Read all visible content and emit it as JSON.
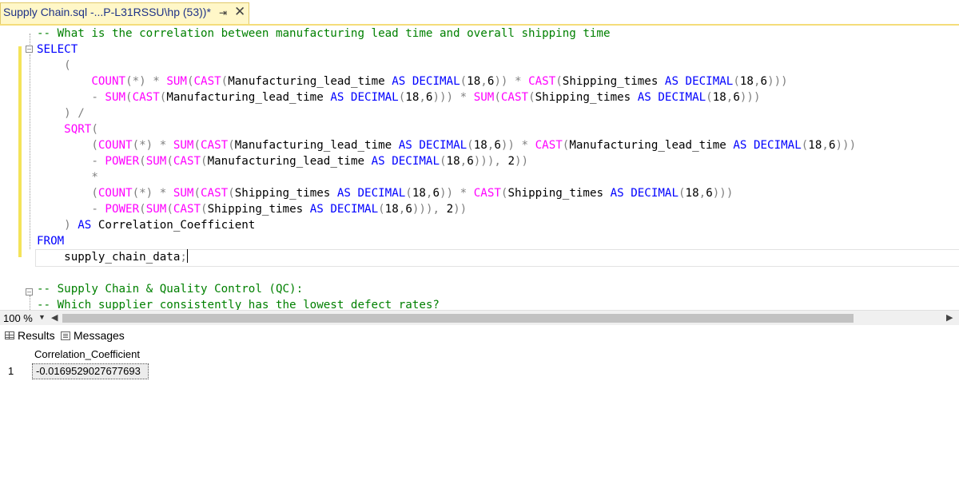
{
  "tab": {
    "title": "Supply Chain.sql -...P-L31RSSU\\hp (53))*",
    "pin_icon": "pin-icon",
    "close_icon": "close-icon"
  },
  "editor": {
    "lines": [
      [
        {
          "t": "-- What is the correlation between manufacturing lead time and overall shipping time",
          "c": "cm"
        }
      ],
      [
        {
          "t": "SELECT",
          "c": "kw"
        }
      ],
      [
        {
          "t": "    (",
          "c": "gr"
        }
      ],
      [
        {
          "t": "        ",
          "c": "tx"
        },
        {
          "t": "COUNT",
          "c": "fn"
        },
        {
          "t": "(*) * ",
          "c": "gr"
        },
        {
          "t": "SUM",
          "c": "fn"
        },
        {
          "t": "(",
          "c": "gr"
        },
        {
          "t": "CAST",
          "c": "fn"
        },
        {
          "t": "(",
          "c": "gr"
        },
        {
          "t": "Manufacturing_lead_time ",
          "c": "tx"
        },
        {
          "t": "AS DECIMAL",
          "c": "kw"
        },
        {
          "t": "(",
          "c": "gr"
        },
        {
          "t": "18",
          "c": "tx"
        },
        {
          "t": ",",
          "c": "gr"
        },
        {
          "t": "6",
          "c": "tx"
        },
        {
          "t": ")) * ",
          "c": "gr"
        },
        {
          "t": "CAST",
          "c": "fn"
        },
        {
          "t": "(",
          "c": "gr"
        },
        {
          "t": "Shipping_times ",
          "c": "tx"
        },
        {
          "t": "AS DECIMAL",
          "c": "kw"
        },
        {
          "t": "(",
          "c": "gr"
        },
        {
          "t": "18",
          "c": "tx"
        },
        {
          "t": ",",
          "c": "gr"
        },
        {
          "t": "6",
          "c": "tx"
        },
        {
          "t": ")))",
          "c": "gr"
        }
      ],
      [
        {
          "t": "        - ",
          "c": "gr"
        },
        {
          "t": "SUM",
          "c": "fn"
        },
        {
          "t": "(",
          "c": "gr"
        },
        {
          "t": "CAST",
          "c": "fn"
        },
        {
          "t": "(",
          "c": "gr"
        },
        {
          "t": "Manufacturing_lead_time ",
          "c": "tx"
        },
        {
          "t": "AS DECIMAL",
          "c": "kw"
        },
        {
          "t": "(",
          "c": "gr"
        },
        {
          "t": "18",
          "c": "tx"
        },
        {
          "t": ",",
          "c": "gr"
        },
        {
          "t": "6",
          "c": "tx"
        },
        {
          "t": "))) * ",
          "c": "gr"
        },
        {
          "t": "SUM",
          "c": "fn"
        },
        {
          "t": "(",
          "c": "gr"
        },
        {
          "t": "CAST",
          "c": "fn"
        },
        {
          "t": "(",
          "c": "gr"
        },
        {
          "t": "Shipping_times ",
          "c": "tx"
        },
        {
          "t": "AS DECIMAL",
          "c": "kw"
        },
        {
          "t": "(",
          "c": "gr"
        },
        {
          "t": "18",
          "c": "tx"
        },
        {
          "t": ",",
          "c": "gr"
        },
        {
          "t": "6",
          "c": "tx"
        },
        {
          "t": ")))",
          "c": "gr"
        }
      ],
      [
        {
          "t": "    ) /",
          "c": "gr"
        }
      ],
      [
        {
          "t": "    ",
          "c": "tx"
        },
        {
          "t": "SQRT",
          "c": "fn"
        },
        {
          "t": "(",
          "c": "gr"
        }
      ],
      [
        {
          "t": "        (",
          "c": "gr"
        },
        {
          "t": "COUNT",
          "c": "fn"
        },
        {
          "t": "(*) * ",
          "c": "gr"
        },
        {
          "t": "SUM",
          "c": "fn"
        },
        {
          "t": "(",
          "c": "gr"
        },
        {
          "t": "CAST",
          "c": "fn"
        },
        {
          "t": "(",
          "c": "gr"
        },
        {
          "t": "Manufacturing_lead_time ",
          "c": "tx"
        },
        {
          "t": "AS DECIMAL",
          "c": "kw"
        },
        {
          "t": "(",
          "c": "gr"
        },
        {
          "t": "18",
          "c": "tx"
        },
        {
          "t": ",",
          "c": "gr"
        },
        {
          "t": "6",
          "c": "tx"
        },
        {
          "t": ")) * ",
          "c": "gr"
        },
        {
          "t": "CAST",
          "c": "fn"
        },
        {
          "t": "(",
          "c": "gr"
        },
        {
          "t": "Manufacturing_lead_time ",
          "c": "tx"
        },
        {
          "t": "AS DECIMAL",
          "c": "kw"
        },
        {
          "t": "(",
          "c": "gr"
        },
        {
          "t": "18",
          "c": "tx"
        },
        {
          "t": ",",
          "c": "gr"
        },
        {
          "t": "6",
          "c": "tx"
        },
        {
          "t": ")))",
          "c": "gr"
        }
      ],
      [
        {
          "t": "        - ",
          "c": "gr"
        },
        {
          "t": "POWER",
          "c": "fn"
        },
        {
          "t": "(",
          "c": "gr"
        },
        {
          "t": "SUM",
          "c": "fn"
        },
        {
          "t": "(",
          "c": "gr"
        },
        {
          "t": "CAST",
          "c": "fn"
        },
        {
          "t": "(",
          "c": "gr"
        },
        {
          "t": "Manufacturing_lead_time ",
          "c": "tx"
        },
        {
          "t": "AS DECIMAL",
          "c": "kw"
        },
        {
          "t": "(",
          "c": "gr"
        },
        {
          "t": "18",
          "c": "tx"
        },
        {
          "t": ",",
          "c": "gr"
        },
        {
          "t": "6",
          "c": "tx"
        },
        {
          "t": "))), ",
          "c": "gr"
        },
        {
          "t": "2",
          "c": "tx"
        },
        {
          "t": "))",
          "c": "gr"
        }
      ],
      [
        {
          "t": "        *",
          "c": "gr"
        }
      ],
      [
        {
          "t": "        (",
          "c": "gr"
        },
        {
          "t": "COUNT",
          "c": "fn"
        },
        {
          "t": "(*) * ",
          "c": "gr"
        },
        {
          "t": "SUM",
          "c": "fn"
        },
        {
          "t": "(",
          "c": "gr"
        },
        {
          "t": "CAST",
          "c": "fn"
        },
        {
          "t": "(",
          "c": "gr"
        },
        {
          "t": "Shipping_times ",
          "c": "tx"
        },
        {
          "t": "AS DECIMAL",
          "c": "kw"
        },
        {
          "t": "(",
          "c": "gr"
        },
        {
          "t": "18",
          "c": "tx"
        },
        {
          "t": ",",
          "c": "gr"
        },
        {
          "t": "6",
          "c": "tx"
        },
        {
          "t": ")) * ",
          "c": "gr"
        },
        {
          "t": "CAST",
          "c": "fn"
        },
        {
          "t": "(",
          "c": "gr"
        },
        {
          "t": "Shipping_times ",
          "c": "tx"
        },
        {
          "t": "AS DECIMAL",
          "c": "kw"
        },
        {
          "t": "(",
          "c": "gr"
        },
        {
          "t": "18",
          "c": "tx"
        },
        {
          "t": ",",
          "c": "gr"
        },
        {
          "t": "6",
          "c": "tx"
        },
        {
          "t": ")))",
          "c": "gr"
        }
      ],
      [
        {
          "t": "        - ",
          "c": "gr"
        },
        {
          "t": "POWER",
          "c": "fn"
        },
        {
          "t": "(",
          "c": "gr"
        },
        {
          "t": "SUM",
          "c": "fn"
        },
        {
          "t": "(",
          "c": "gr"
        },
        {
          "t": "CAST",
          "c": "fn"
        },
        {
          "t": "(",
          "c": "gr"
        },
        {
          "t": "Shipping_times ",
          "c": "tx"
        },
        {
          "t": "AS DECIMAL",
          "c": "kw"
        },
        {
          "t": "(",
          "c": "gr"
        },
        {
          "t": "18",
          "c": "tx"
        },
        {
          "t": ",",
          "c": "gr"
        },
        {
          "t": "6",
          "c": "tx"
        },
        {
          "t": "))), ",
          "c": "gr"
        },
        {
          "t": "2",
          "c": "tx"
        },
        {
          "t": "))",
          "c": "gr"
        }
      ],
      [
        {
          "t": "    ) ",
          "c": "gr"
        },
        {
          "t": "AS ",
          "c": "kw"
        },
        {
          "t": "Correlation_Coefficient",
          "c": "tx"
        }
      ],
      [
        {
          "t": "FROM",
          "c": "kw"
        }
      ],
      [
        {
          "t": "    supply_chain_data",
          "c": "tx"
        },
        {
          "t": ";",
          "c": "gr"
        }
      ],
      [
        {
          "t": "",
          "c": "tx"
        }
      ],
      [
        {
          "t": "-- Supply Chain & Quality Control (QC):",
          "c": "cm"
        }
      ],
      [
        {
          "t": "-- Which supplier consistently has the lowest defect rates?",
          "c": "cm"
        }
      ]
    ]
  },
  "zoom": {
    "level": "100 %"
  },
  "results": {
    "tabs": [
      {
        "label": "Results",
        "icon": "grid-icon"
      },
      {
        "label": "Messages",
        "icon": "messages-icon"
      }
    ],
    "columns": [
      "Correlation_Coefficient"
    ],
    "rows": [
      {
        "num": "1",
        "values": [
          "-0.0169529027677693"
        ]
      }
    ]
  }
}
